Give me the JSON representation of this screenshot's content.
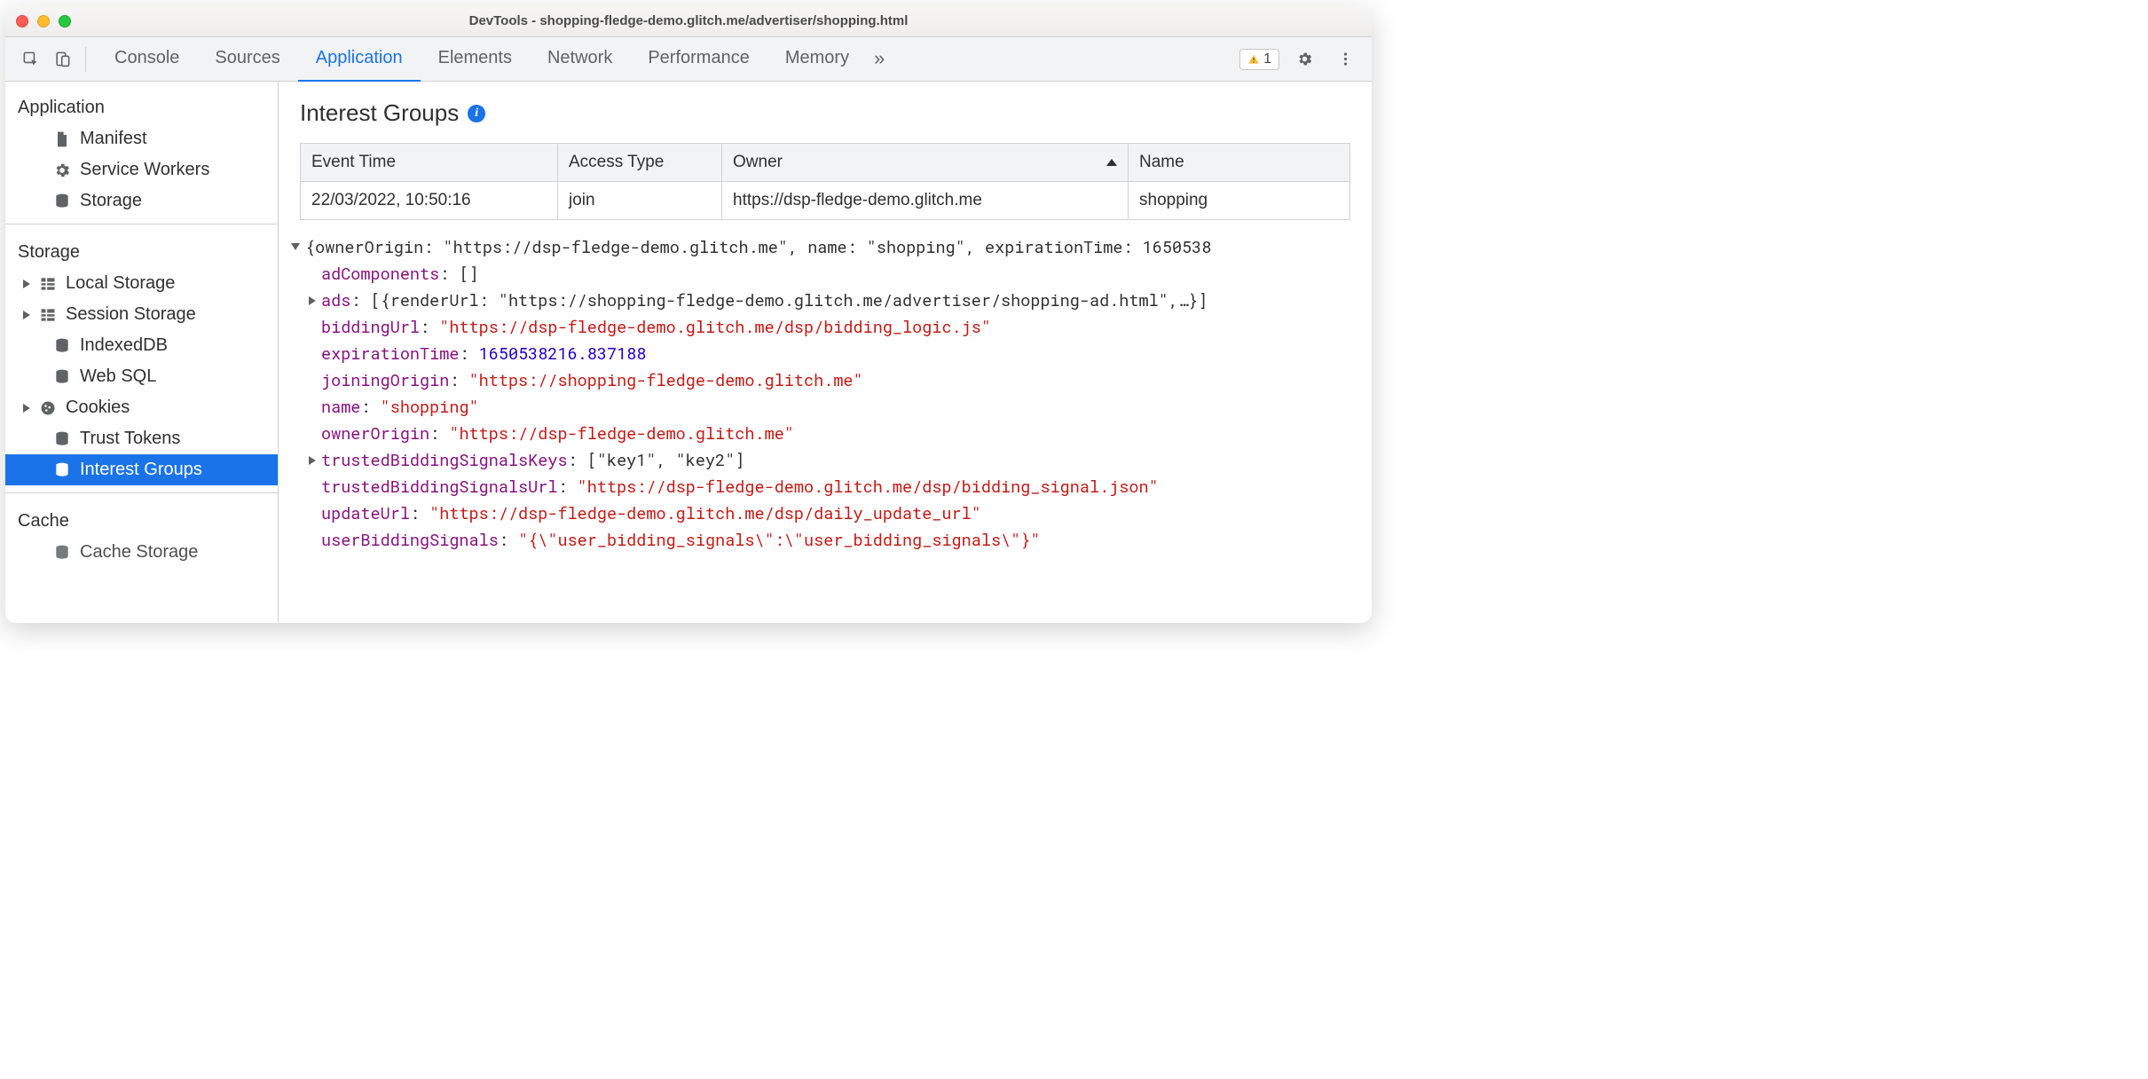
{
  "window": {
    "title": "DevTools - shopping-fledge-demo.glitch.me/advertiser/shopping.html"
  },
  "tabs": {
    "list": [
      "Console",
      "Sources",
      "Application",
      "Elements",
      "Network",
      "Performance",
      "Memory"
    ],
    "active": "Application",
    "overflow_glyph": "»",
    "warning_count": "1"
  },
  "sidebar": {
    "application": {
      "title": "Application",
      "items": [
        "Manifest",
        "Service Workers",
        "Storage"
      ]
    },
    "storage": {
      "title": "Storage",
      "items": [
        "Local Storage",
        "Session Storage",
        "IndexedDB",
        "Web SQL",
        "Cookies",
        "Trust Tokens",
        "Interest Groups"
      ]
    },
    "cache": {
      "title": "Cache",
      "items": [
        "Cache Storage"
      ]
    }
  },
  "page": {
    "title": "Interest Groups"
  },
  "table": {
    "headers": [
      "Event Time",
      "Access Type",
      "Owner",
      "Name"
    ],
    "rows": [
      {
        "event_time": "22/03/2022, 10:50:16",
        "access_type": "join",
        "owner": "https://dsp-fledge-demo.glitch.me",
        "name": "shopping"
      }
    ]
  },
  "detail": {
    "summary": "{ownerOrigin: \"https://dsp-fledge-demo.glitch.me\", name: \"shopping\", expirationTime: 1650538",
    "adComponents": "[]",
    "ads_summary": "[{renderUrl: \"https://shopping-fledge-demo.glitch.me/advertiser/shopping-ad.html\",…}]",
    "biddingUrl": "\"https://dsp-fledge-demo.glitch.me/dsp/bidding_logic.js\"",
    "expirationTime": "1650538216.837188",
    "joiningOrigin": "\"https://shopping-fledge-demo.glitch.me\"",
    "name": "\"shopping\"",
    "ownerOrigin": "\"https://dsp-fledge-demo.glitch.me\"",
    "trustedBiddingSignalsKeys": "[\"key1\", \"key2\"]",
    "trustedBiddingSignalsUrl": "\"https://dsp-fledge-demo.glitch.me/dsp/bidding_signal.json\"",
    "updateUrl": "\"https://dsp-fledge-demo.glitch.me/dsp/daily_update_url\"",
    "userBiddingSignals": "\"{\\\"user_bidding_signals\\\":\\\"user_bidding_signals\\\"}\""
  }
}
